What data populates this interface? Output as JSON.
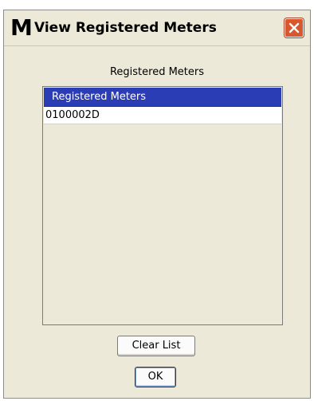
{
  "window": {
    "app_icon_letter": "M",
    "title": "View Registered Meters",
    "close_icon": "close-icon"
  },
  "main": {
    "section_label": "Registered Meters",
    "list": {
      "header": "Registered Meters",
      "items": [
        "0100002D"
      ]
    }
  },
  "buttons": {
    "clear_list": "Clear List",
    "ok": "OK"
  },
  "colors": {
    "window_bg": "#ece9d8",
    "list_header_bg": "#2b3db5",
    "close_button_bg": "#d9572f"
  }
}
